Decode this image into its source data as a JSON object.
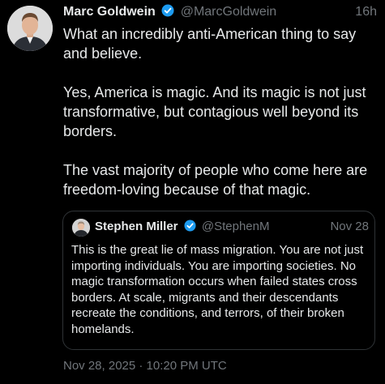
{
  "tweet": {
    "author_name": "Marc Goldwein",
    "author_handle": "@MarcGoldwein",
    "time_ago": "16h",
    "paragraphs": [
      "What an incredibly anti-American thing to say and believe.",
      "Yes, America is magic. And its magic is not just transformative, but contagious well beyond its borders.",
      "The vast majority of people who come here are freedom-loving because of that magic."
    ],
    "timestamp": "Nov 28, 2025 · 10:20 PM UTC"
  },
  "quote": {
    "author_name": "Stephen Miller",
    "author_handle": "@StephenM",
    "date": "Nov 28",
    "text": "This is the great lie of mass migration. You are not just importing individuals. You are importing societies. No magic transformation occurs when failed states cross borders. At scale, migrants and their descendants recreate the conditions, and terrors, of their broken homelands."
  },
  "colors": {
    "background": "#000000",
    "text": "#e7e9ea",
    "muted": "#71767b",
    "verified": "#1d9bf0",
    "border": "#2f3336"
  },
  "icons": {
    "verified": "verified-badge-icon",
    "avatar": "profile-photo",
    "quote_avatar": "profile-photo"
  }
}
